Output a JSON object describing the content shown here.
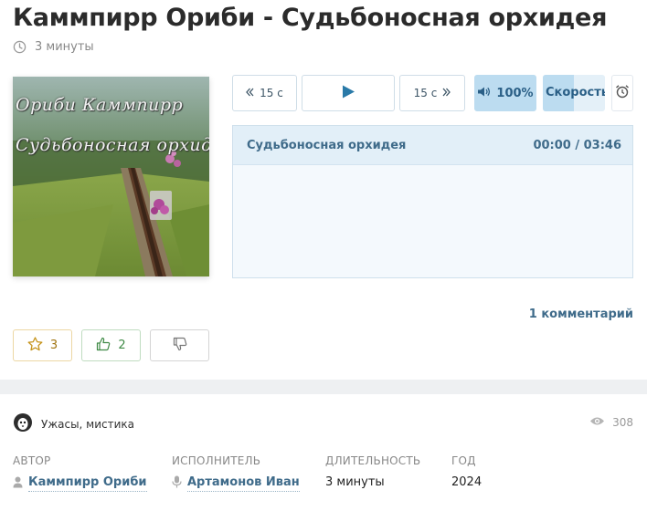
{
  "page": {
    "title": "Каммпирр Ориби - Судьбоносная орхидея",
    "duration": "3 минуты"
  },
  "cover": {
    "line1": "Ориби Каммпирр",
    "line2": "Судьбоносная орхидея"
  },
  "player": {
    "rewind_label": "15 с",
    "forward_label": "15 с",
    "volume_label": "100%",
    "volume_level": 1.0,
    "speed_label": "Скорость",
    "speed_level": 0.5,
    "accent_color": "#bcdcf0",
    "icons": [
      "rewind-icon",
      "play-icon",
      "forward-icon",
      "volume-icon",
      "alarm-clock-icon"
    ]
  },
  "playlist": {
    "track_title": "Судьбоносная орхидея",
    "track_time": "00:00 / 03:46"
  },
  "comments": {
    "link_label": "1 комментарий"
  },
  "ratings": {
    "favorites_count": "3",
    "likes_count": "2",
    "icons": [
      "star-icon",
      "thumbs-up-icon",
      "thumbs-down-icon"
    ]
  },
  "info": {
    "genre": "Ужасы, мистика",
    "views": "308",
    "author_label": "Автор",
    "author_value": "Каммпирр Ориби",
    "performer_label": "Исполнитель",
    "performer_value": "Артамонов Иван",
    "length_label": "Длительность",
    "length_value": "3 минуты",
    "year_label": "Год",
    "year_value": "2024"
  }
}
